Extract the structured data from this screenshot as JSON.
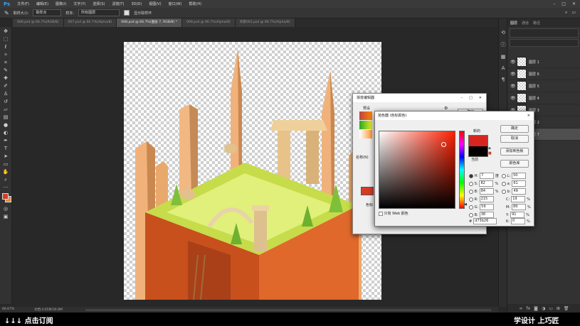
{
  "app": {
    "logo": "Ps"
  },
  "menu": [
    "文件(F)",
    "编辑(E)",
    "图像(I)",
    "文字(Y)",
    "选择(S)",
    "滤镜(T)",
    "3D(D)",
    "视图(V)",
    "窗口(W)",
    "帮助(H)"
  ],
  "options": {
    "sample_size_label": "取样大小:",
    "sample_size_value": "取样点",
    "sample_label": "样本:",
    "sample_value": "所有图层",
    "show_ring_label": "显示取样环"
  },
  "tabs": [
    "006.psd @ 66.7%(RGB/8)",
    "007.psd @ 66.7%(Alpha/8)",
    "008.psd @ 66.7%(图层 7, RGB/8) *",
    "009.psd @ 66.7%(Alpha/8)",
    "背景002.psd @ 66.7%(Alpha/8)"
  ],
  "status": {
    "zoom": "66.67%",
    "doc": "文档:4.65M/30.8M"
  },
  "layers_panel": {
    "tabs": [
      "图层",
      "通道",
      "路径"
    ],
    "layers": [
      {
        "name": "图层 1",
        "selected": false
      },
      {
        "name": "图层 6",
        "selected": false
      },
      {
        "name": "图层 5",
        "selected": false
      },
      {
        "name": "图层 4",
        "selected": false
      },
      {
        "name": "图层 3",
        "selected": false
      },
      {
        "name": "图层 2",
        "selected": false
      },
      {
        "name": "图层 7",
        "selected": true
      }
    ]
  },
  "gradient_editor": {
    "title": "渐变编辑器",
    "presets_label": "预设",
    "name_label": "名称(N)",
    "stop_label": "色标",
    "buttons": [
      "确定"
    ]
  },
  "color_picker": {
    "title": "拾色器 (色标颜色)",
    "buttons": {
      "ok": "确定",
      "cancel": "取消",
      "add_swatch": "添加到色板",
      "library": "颜色库"
    },
    "new_label": "新的",
    "current_label": "当前",
    "web_only_label": "只有 Web 颜色",
    "new_color": "#D7261E",
    "current_color": "#000000",
    "hsb": [
      {
        "label": "H:",
        "value": "7",
        "unit": "度"
      },
      {
        "label": "S:",
        "value": "82",
        "unit": "%"
      },
      {
        "label": "B:",
        "value": "84",
        "unit": "%"
      }
    ],
    "lab": [
      {
        "label": "L:",
        "value": "50"
      },
      {
        "label": "a:",
        "value": "61"
      },
      {
        "label": "b:",
        "value": "49"
      }
    ],
    "rgb": [
      {
        "label": "R:",
        "value": "215"
      },
      {
        "label": "G:",
        "value": "59"
      },
      {
        "label": "B:",
        "value": "38"
      }
    ],
    "cmyk": [
      {
        "label": "C:",
        "value": "19",
        "unit": "%"
      },
      {
        "label": "M:",
        "value": "89",
        "unit": "%"
      },
      {
        "label": "Y:",
        "value": "91",
        "unit": "%"
      },
      {
        "label": "K:",
        "value": "0",
        "unit": "%"
      }
    ],
    "hex_label": "#",
    "hex": "d73b26"
  },
  "bottom": {
    "subscribe": "↓↓↓ 点击订阅",
    "brand": "学设计 上巧匠"
  }
}
